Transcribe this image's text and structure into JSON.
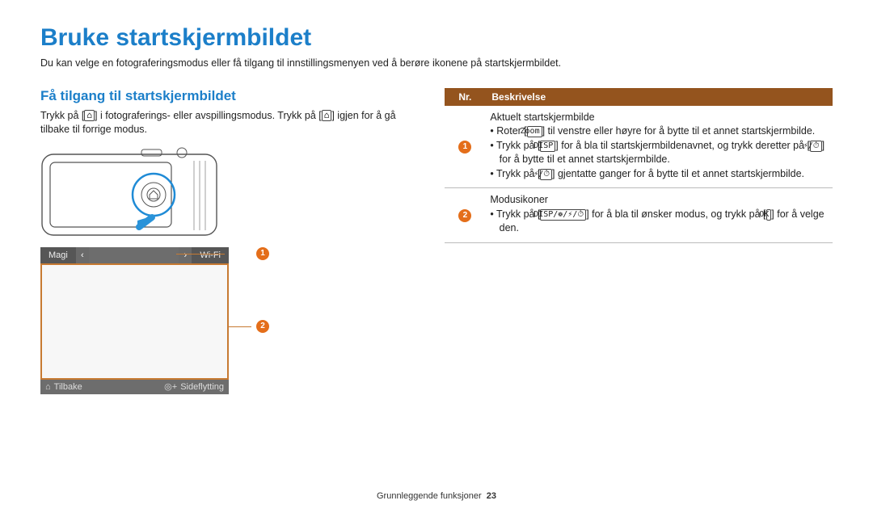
{
  "heading": "Bruke startskjermbildet",
  "intro": "Du kan velge en fotograferingsmodus eller få tilgang til innstillingsmenyen ved å berøre ikonene på startskjermbildet.",
  "left": {
    "subheading": "Få tilgang til startskjermbildet",
    "para_pre": "Trykk på [",
    "para_mid1": "] i fotograferings- eller avspillingsmodus. Trykk på [",
    "para_post": "] igjen for å gå tilbake til forrige modus.",
    "screen": {
      "tab_left": "Magi",
      "tab_right": "Wi-Fi",
      "bottom_back": "Tilbake",
      "bottom_move": "Sideflytting"
    }
  },
  "table": {
    "header_nr": "Nr.",
    "header_desc": "Beskrivelse",
    "rows": [
      {
        "num": "1",
        "title": "Aktuelt startskjermbilde",
        "bullets": [
          {
            "pre": "Roter [",
            "icon": "Zoom",
            "post": "] til venstre eller høyre for å bytte til et annet startskjermbilde."
          },
          {
            "pre": "Trykk på [",
            "icon": "DISP",
            "mid": "] for å bla til startskjermbildenavnet, og trykk deretter på [",
            "icon2": "⚡/⏱",
            "post": "] for å bytte til et annet startskjermbilde."
          },
          {
            "pre": "Trykk på [",
            "icon": "⚡/⏱",
            "post": "] gjentatte ganger for å bytte til et annet startskjermbilde."
          }
        ]
      },
      {
        "num": "2",
        "title": "Modusikoner",
        "bullets": [
          {
            "pre": "Trykk på [",
            "icon": "DISP/❁/⚡/⏱",
            "mid": "] for å bla til ønsker modus, og trykk på [",
            "icon2": "OK",
            "post": "] for å velge den."
          }
        ]
      }
    ]
  },
  "footer": {
    "section": "Grunnleggende funksjoner",
    "page": "23"
  }
}
